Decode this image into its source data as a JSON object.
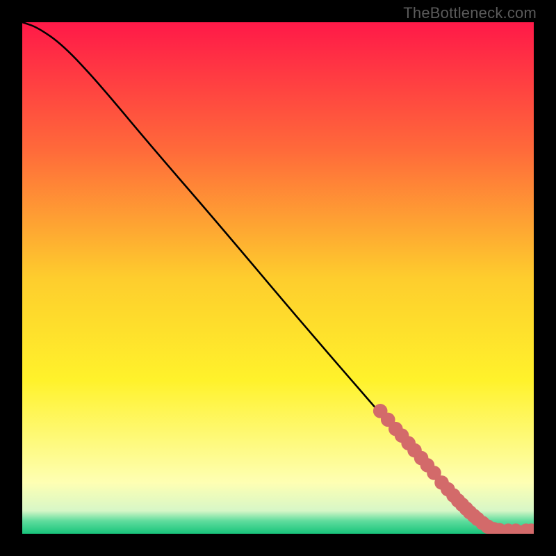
{
  "watermark": "TheBottleneck.com",
  "chart_data": {
    "type": "line",
    "title": "",
    "xlabel": "",
    "ylabel": "",
    "xlim": [
      0,
      100
    ],
    "ylim": [
      0,
      100
    ],
    "grid": false,
    "legend": false,
    "background_gradient": {
      "stops": [
        {
          "pos": 0.0,
          "color": "#ff1948"
        },
        {
          "pos": 0.25,
          "color": "#ff6a3a"
        },
        {
          "pos": 0.5,
          "color": "#fecd2d"
        },
        {
          "pos": 0.7,
          "color": "#fff22b"
        },
        {
          "pos": 0.9,
          "color": "#feffb3"
        },
        {
          "pos": 0.955,
          "color": "#d7f7c7"
        },
        {
          "pos": 0.975,
          "color": "#5fdc9d"
        },
        {
          "pos": 1.0,
          "color": "#18c47b"
        }
      ]
    },
    "curve": {
      "x": [
        0,
        3,
        8,
        15,
        25,
        38,
        54,
        70,
        80,
        86,
        90,
        93,
        96,
        100
      ],
      "y": [
        100,
        99,
        95.5,
        88,
        76,
        61,
        42,
        23.5,
        12,
        6,
        3,
        1.5,
        0.7,
        0.6
      ]
    },
    "markers": {
      "color": "#d36a6a",
      "radius_pct": 1.4,
      "points": [
        {
          "x": 70.0,
          "y": 24.0
        },
        {
          "x": 71.5,
          "y": 22.3
        },
        {
          "x": 73.0,
          "y": 20.5
        },
        {
          "x": 74.2,
          "y": 19.2
        },
        {
          "x": 75.5,
          "y": 17.7
        },
        {
          "x": 76.7,
          "y": 16.3
        },
        {
          "x": 78.0,
          "y": 14.8
        },
        {
          "x": 79.2,
          "y": 13.4
        },
        {
          "x": 80.5,
          "y": 11.9
        },
        {
          "x": 82.0,
          "y": 10.0
        },
        {
          "x": 83.2,
          "y": 8.7
        },
        {
          "x": 84.3,
          "y": 7.5
        },
        {
          "x": 85.2,
          "y": 6.5
        },
        {
          "x": 86.0,
          "y": 5.7
        },
        {
          "x": 86.8,
          "y": 4.9
        },
        {
          "x": 87.5,
          "y": 4.2
        },
        {
          "x": 88.3,
          "y": 3.5
        },
        {
          "x": 89.0,
          "y": 2.9
        },
        {
          "x": 90.0,
          "y": 2.1
        },
        {
          "x": 91.0,
          "y": 1.4
        },
        {
          "x": 92.2,
          "y": 0.9
        },
        {
          "x": 93.3,
          "y": 0.7
        },
        {
          "x": 95.0,
          "y": 0.6
        },
        {
          "x": 96.5,
          "y": 0.6
        },
        {
          "x": 98.5,
          "y": 0.6
        },
        {
          "x": 99.5,
          "y": 0.6
        }
      ]
    }
  }
}
